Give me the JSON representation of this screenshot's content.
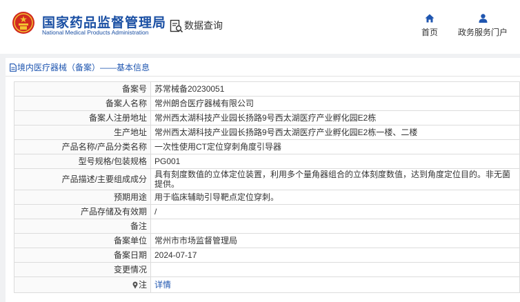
{
  "header": {
    "org_name_cn": "国家药品监督管理局",
    "org_name_en": "National Medical Products Administration",
    "query_label": "数据查询",
    "nav": [
      {
        "label": "首页",
        "icon": "home-icon"
      },
      {
        "label": "政务服务门户",
        "icon": "user-icon"
      }
    ]
  },
  "breadcrumb": {
    "label": "境内医疗器械（备案）——基本信息",
    "icon": "document-icon"
  },
  "record": [
    {
      "label": "备案号",
      "value": "苏常械备20230051"
    },
    {
      "label": "备案人名称",
      "value": "常州朗合医疗器械有限公司"
    },
    {
      "label": "备案人注册地址",
      "value": "常州西太湖科技产业园长扬路9号西太湖医疗产业孵化园E2栋"
    },
    {
      "label": "生产地址",
      "value": "常州西太湖科技产业园长扬路9号西太湖医疗产业孵化园E2栋一楼、二楼"
    },
    {
      "label": "产品名称/产品分类名称",
      "value": "一次性使用CT定位穿刺角度引导器"
    },
    {
      "label": "型号规格/包装规格",
      "value": "PG001"
    },
    {
      "label": "产品描述/主要组成成分",
      "value": "具有刻度数值的立体定位装置，利用多个量角器组合的立体刻度数值，达到角度定位目的。非无菌提供。"
    },
    {
      "label": "预期用途",
      "value": "用于临床辅助引导靶点定位穿刺。"
    },
    {
      "label": "产品存储及有效期",
      "value": "/"
    },
    {
      "label": "备注",
      "value": ""
    },
    {
      "label": "备案单位",
      "value": "常州市市场监督管理局"
    },
    {
      "label": "备案日期",
      "value": "2024-07-17"
    },
    {
      "label": "变更情况",
      "value": ""
    }
  ],
  "note_row": {
    "label": "注",
    "link_text": "详情",
    "icon": "pin-icon"
  },
  "colors": {
    "brand_blue": "#1a4fa3",
    "link_blue": "#1f56b0",
    "emblem_red": "#d12a1f",
    "emblem_gold": "#f2c230"
  }
}
